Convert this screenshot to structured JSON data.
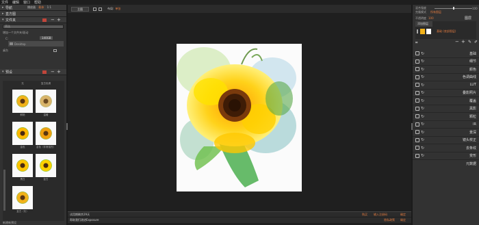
{
  "menubar": {
    "items": [
      "文件",
      "编辑",
      "窗口",
      "帮助"
    ]
  },
  "left_panel": {
    "navigation": {
      "title": "导航",
      "mode_a": "播放器",
      "mode_b": "载体",
      "zoom": "1:1"
    },
    "histogram": {
      "title": "直方图"
    },
    "folders": {
      "title": "文件夹",
      "filter_placeholder": "筛选",
      "add_hint": "增加一个文件夹/驱动",
      "drive": "C:",
      "drive_size": "140GB",
      "desktop": "Desktop",
      "footer": "桌台"
    },
    "presets": {
      "title": "预设",
      "items": [
        {
          "label": "无"
        },
        {
          "label": "复古色调"
        },
        {
          "label": "鲜艳"
        },
        {
          "label": "温暖"
        },
        {
          "label": "金色"
        },
        {
          "label": "金色（非常强烈）"
        },
        {
          "label": "黑白"
        },
        {
          "label": "复古"
        },
        {
          "label": "复古（灰）"
        }
      ],
      "footer": "新建新预设"
    }
  },
  "center": {
    "topbar": {
      "button": "主图",
      "info_label": "布局:",
      "info_value": "单张"
    },
    "status1": {
      "left": "试用期剩余29天",
      "right_a": "购买",
      "right_b": "输入注册码",
      "right_c": "确定"
    },
    "status2": {
      "left": "帮助我们改进Exposure",
      "right_a": "隐私政策",
      "right_b": "确定"
    }
  },
  "right_panel": {
    "top": {
      "row1": "混合强度",
      "row1_val": "100",
      "row2": "克隆模式",
      "row2_val": "所有图层",
      "row3": "不透明度",
      "row3_val": "100",
      "layers_label": "图层",
      "add_layer": "添加图层",
      "layer_name": "基础 (底部图层)"
    },
    "adjustments": [
      "基础",
      "细节",
      "颜色",
      "色调曲线",
      "LUT",
      "叠影照片",
      "覆盖",
      "黑影",
      "颗粒",
      "IR",
      "景深",
      "镜头校正",
      "去条纹",
      "变形",
      "元数据"
    ]
  },
  "colors": {
    "accent": "#e07a3f",
    "panel": "#323232",
    "canvas_bg": "#1f1f1f"
  }
}
